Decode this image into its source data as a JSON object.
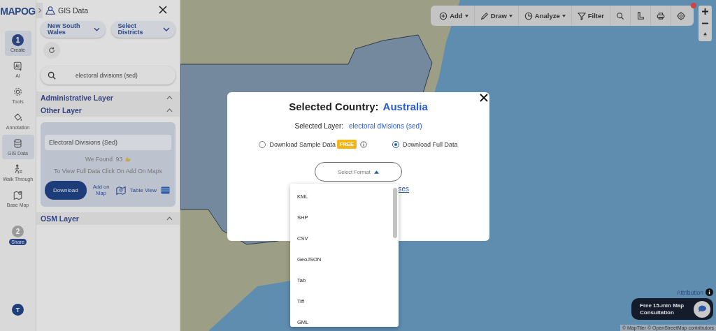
{
  "logo": "MAPOG",
  "rail": {
    "items": [
      {
        "kind": "step",
        "badge": "1",
        "label": "Create",
        "selected": true
      },
      {
        "kind": "tool",
        "label": "AI",
        "selected": false
      },
      {
        "kind": "tool",
        "label": "Tools",
        "selected": false
      },
      {
        "kind": "tool",
        "label": "Annotation",
        "selected": false
      },
      {
        "kind": "tool",
        "label": "GIS Data",
        "selected": true
      },
      {
        "kind": "tool",
        "label": "Walk Through",
        "selected": false
      },
      {
        "kind": "tool",
        "label": "Base Map",
        "selected": false
      },
      {
        "kind": "step",
        "badge": "2",
        "label": "Share",
        "selected": false
      }
    ],
    "avatar": "T"
  },
  "panel": {
    "title": "GIS Data",
    "filters": [
      {
        "label": "New South Wales"
      },
      {
        "label": "Select Districts"
      }
    ],
    "search": {
      "value": "electoral divisions (sed)"
    },
    "sections": [
      {
        "title": "Administrative Layer",
        "expanded": true
      },
      {
        "title": "Other Layer",
        "expanded": true
      }
    ],
    "card": {
      "layer": "Electoral Divisions (Sed)",
      "found": "We Found  93",
      "hint": "To View Full Data Click On Add On Maps",
      "download": "Download",
      "add_on_map": "Add on Map",
      "table_view": "Table View"
    },
    "osm_section": {
      "title": "OSM Layer",
      "expanded": true
    }
  },
  "toolbar": {
    "items": [
      {
        "kind": "menu",
        "label": "Add"
      },
      {
        "kind": "menu",
        "label": "Draw"
      },
      {
        "kind": "menu",
        "label": "Analyze"
      },
      {
        "kind": "button",
        "label": "Filter"
      },
      {
        "kind": "icon"
      },
      {
        "kind": "icon"
      },
      {
        "kind": "icon"
      },
      {
        "kind": "icon"
      }
    ]
  },
  "modal": {
    "title": "Selected Country:",
    "country": "Australia",
    "layer_label": "Selected Layer:",
    "layer_value": "electoral divisions (sed)",
    "options": [
      {
        "label": "Download Sample Data",
        "badge": "FREE",
        "info": true,
        "selected": false
      },
      {
        "label": "Download Full Data",
        "info": false,
        "selected": true
      }
    ],
    "format_select": {
      "placeholder": "Select Format",
      "expanded": true
    },
    "format_options": [
      "KML",
      "SHP",
      "CSV",
      "GeoJSON",
      "Tab",
      "Tiff",
      "GML"
    ],
    "link_fragment": "ses"
  },
  "attribution": "Attribution",
  "consultation": "Free 15-min Map Consultation",
  "credits": "© MapTiler © OpenStreetMap contributors"
}
